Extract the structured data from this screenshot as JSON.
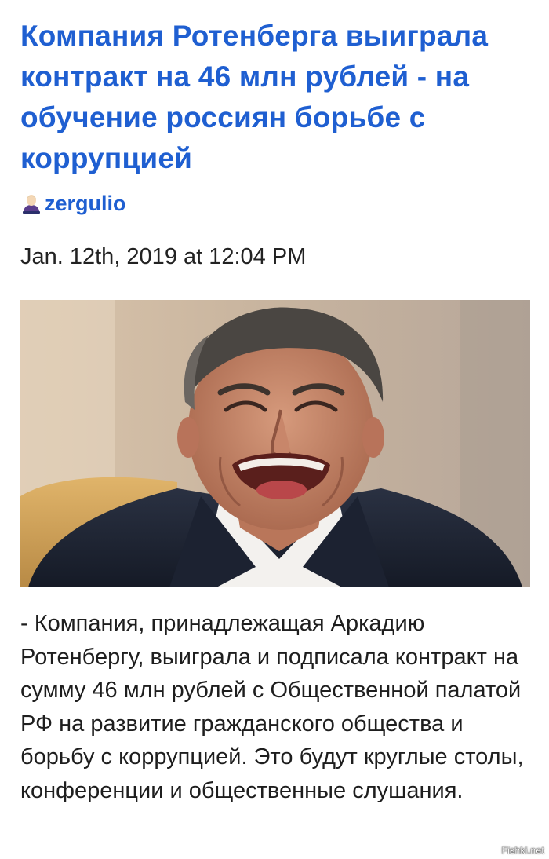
{
  "article": {
    "title": "Компания Ротенберга выиграла контракт на 46 млн рублей - на обучение россиян борьбе с коррупцией",
    "author": {
      "name": "zergulio",
      "icon": "user-avatar-icon"
    },
    "date": "Jan. 12th, 2019 at 12:04 PM",
    "image": {
      "subject": "laughing-man-photo"
    },
    "body": "- Компания, принадлежащая Аркадию Ротенбергу, выиграла и подписала контракт на сумму 46 млн рублей с Общественной палатой РФ на развитие гражданского общества и борьбу с коррупцией. Это будут круглые столы, конференции и общественные слушания."
  },
  "watermark": "Fishki.net",
  "colors": {
    "title": "#1f5fd1",
    "author": "#1f5fd1",
    "text": "#1e1e1e",
    "background": "#ffffff"
  }
}
